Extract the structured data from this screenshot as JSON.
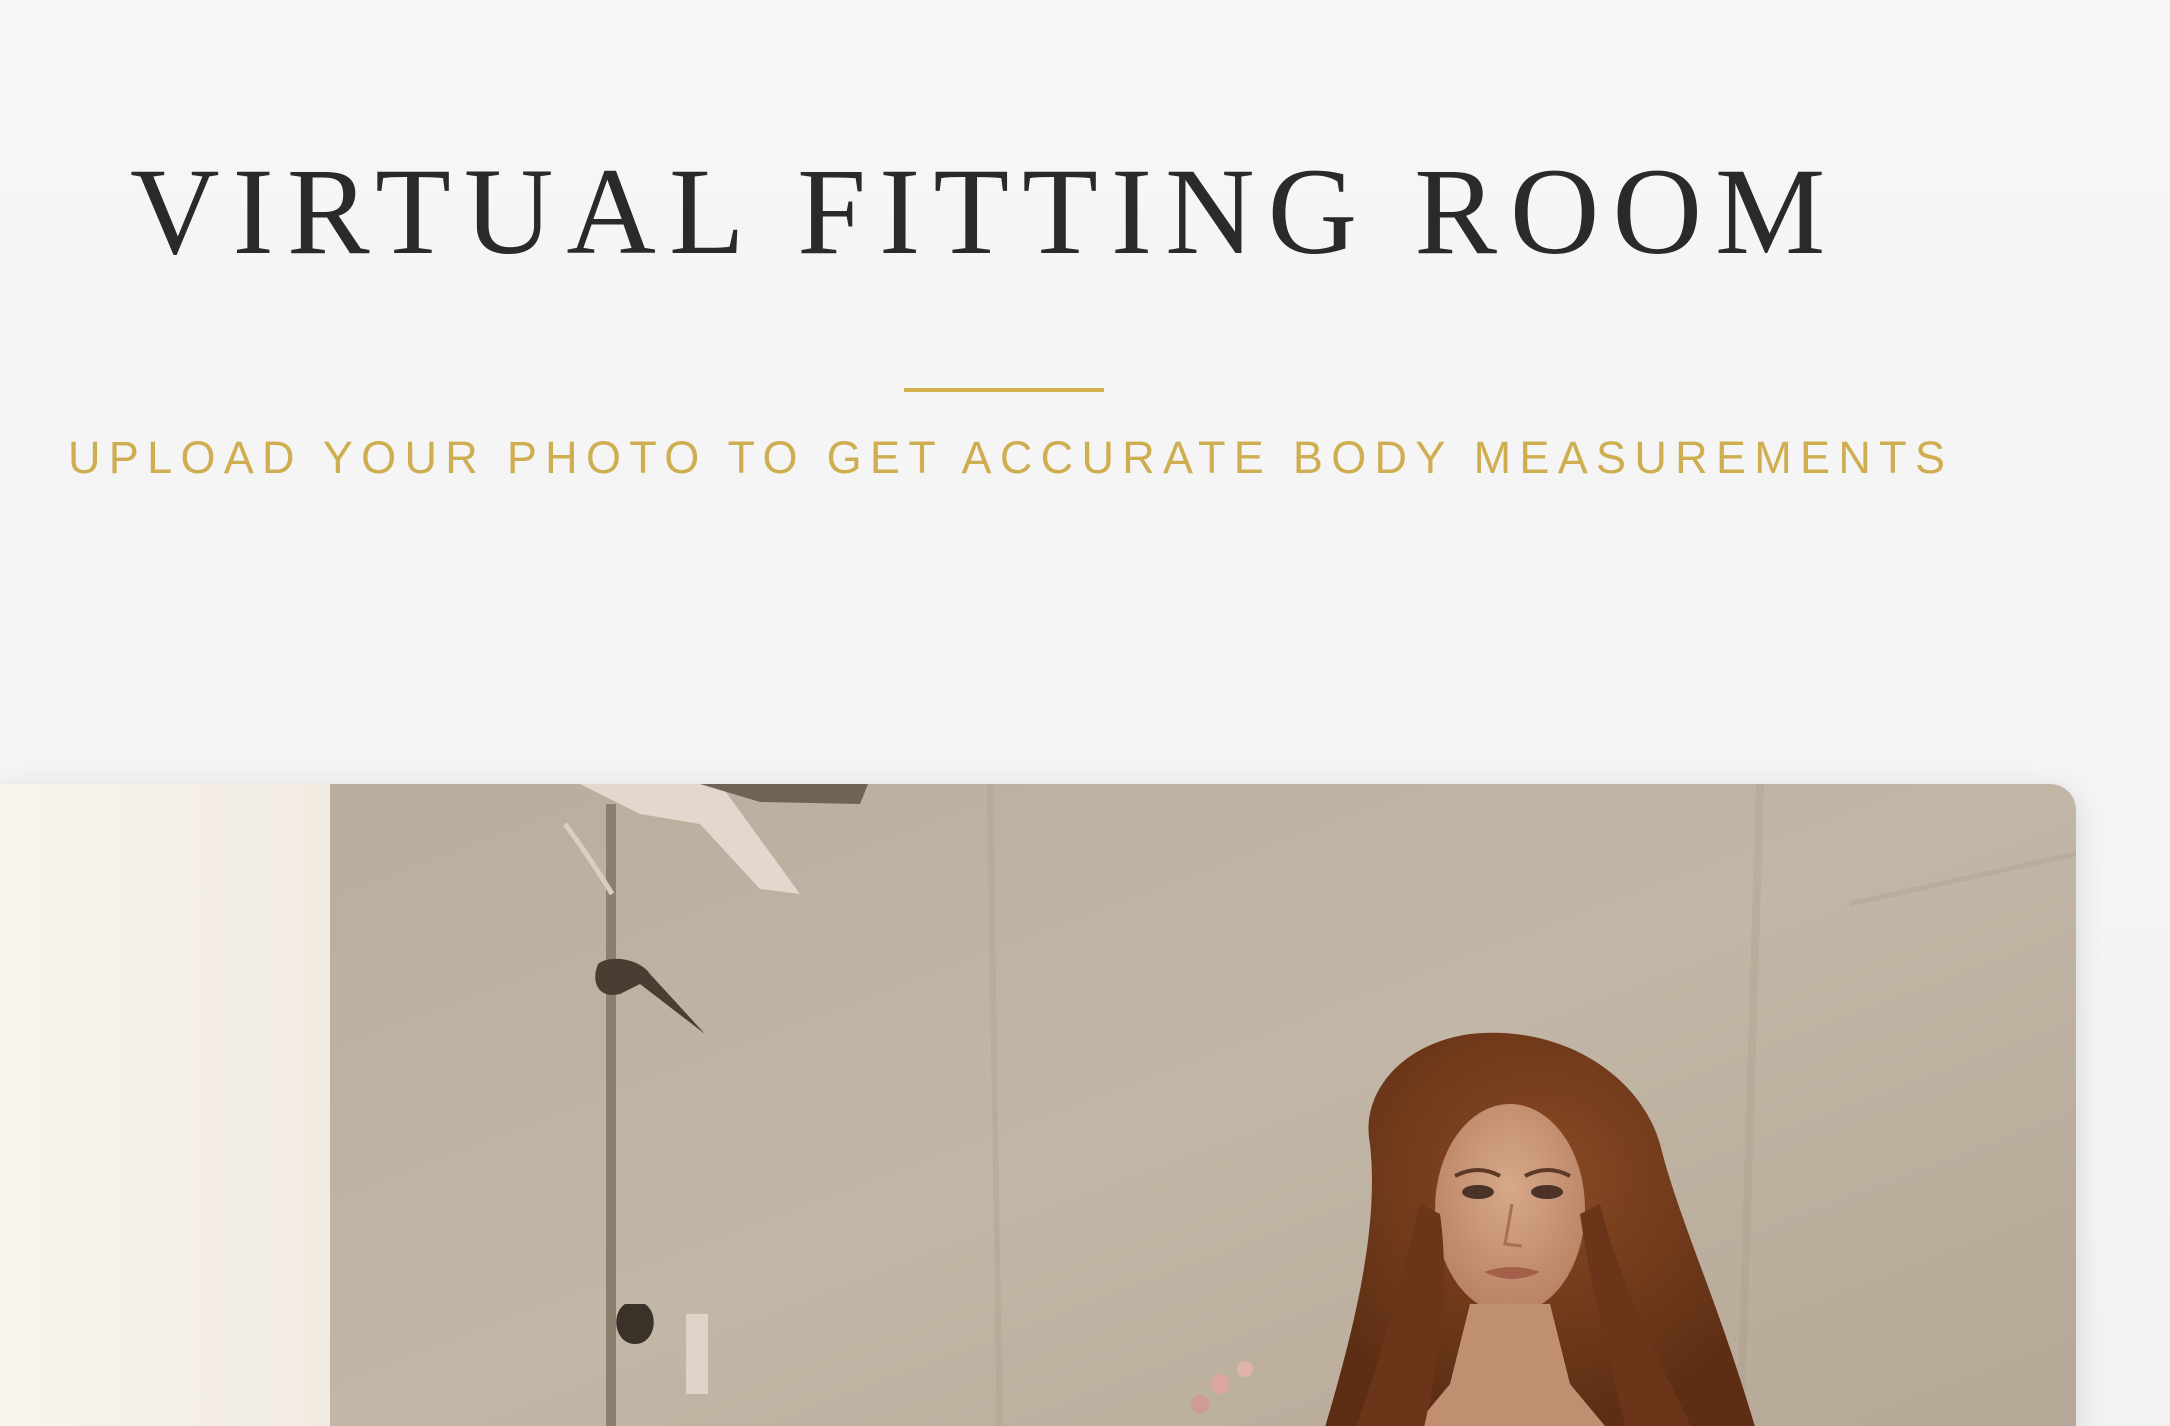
{
  "header": {
    "title": "VIRTUAL FITTING ROOM",
    "subtitle": "UPLOAD YOUR PHOTO TO GET ACCURATE BODY MEASUREMENTS"
  },
  "colors": {
    "accent_gold": "#d4b04a",
    "title_text": "#2a2a2a",
    "background": "#f4f4f4"
  },
  "photo": {
    "alt": "uploaded-photo"
  }
}
